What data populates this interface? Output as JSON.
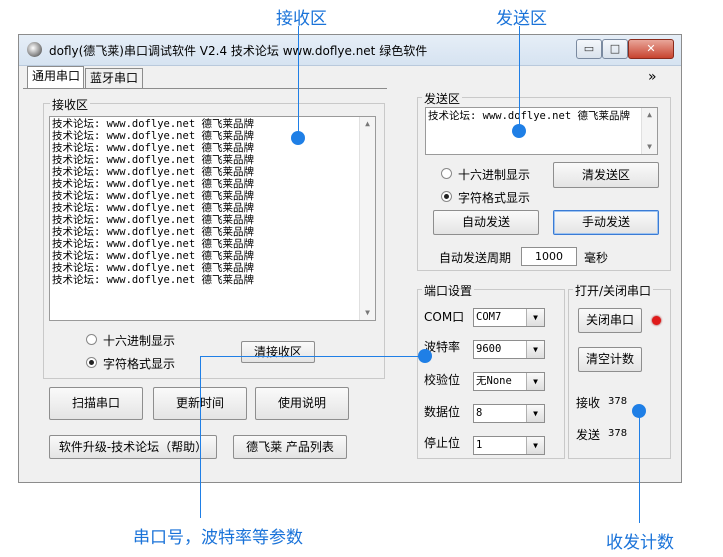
{
  "callouts": {
    "rx_area": "接收区",
    "tx_area": "发送区",
    "port_params": "串口号，波特率等参数",
    "counts": "收发计数"
  },
  "window": {
    "title": "dofly(德飞莱)串口调试软件 V2.4 技术论坛 www.doflye.net 绿色软件",
    "min": "▭",
    "max": "□",
    "close": "✕"
  },
  "tabs": [
    "通用串口",
    "蓝牙串口"
  ],
  "expand_label": "»",
  "receive": {
    "legend": "接收区",
    "lines": [
      "技术论坛: www.doflye.net 德飞莱品牌",
      "技术论坛: www.doflye.net 德飞莱品牌",
      "技术论坛: www.doflye.net 德飞莱品牌",
      "技术论坛: www.doflye.net 德飞莱品牌",
      "技术论坛: www.doflye.net 德飞莱品牌",
      "技术论坛: www.doflye.net 德飞莱品牌",
      "技术论坛: www.doflye.net 德飞莱品牌",
      "技术论坛: www.doflye.net 德飞莱品牌",
      "技术论坛: www.doflye.net 德飞莱品牌",
      "技术论坛: www.doflye.net 德飞莱品牌",
      "技术论坛: www.doflye.net 德飞莱品牌",
      "技术论坛: www.doflye.net 德飞莱品牌",
      "技术论坛: www.doflye.net 德飞莱品牌",
      "技术论坛: www.doflye.net 德飞莱品牌"
    ],
    "hex_label": "十六进制显示",
    "char_label": "字符格式显示",
    "clear_button": "清接收区"
  },
  "bottom_buttons": {
    "scan": "扫描串口",
    "update_time": "更新时间",
    "help": "使用说明",
    "upgrade": "软件升级-技术论坛（帮助）",
    "products": "德飞莱 产品列表"
  },
  "send": {
    "legend": "发送区",
    "text": "技术论坛: www.doflye.net 德飞莱品牌",
    "hex_label": "十六进制显示",
    "char_label": "字符格式显示",
    "clear_button": "清发送区",
    "auto_button": "自动发送",
    "manual_button": "手动发送",
    "period_label": "自动发送周期",
    "period_value": "1000",
    "period_unit": "毫秒"
  },
  "port": {
    "legend": "端口设置",
    "com_label": "COM口",
    "com_value": "COM7",
    "baud_label": "波特率",
    "baud_value": "9600",
    "parity_label": "校验位",
    "parity_value": "无None",
    "data_label": "数据位",
    "data_value": "8",
    "stop_label": "停止位",
    "stop_value": "1"
  },
  "openclose": {
    "legend": "打开/关闭串口",
    "close_button": "关闭串口",
    "clear_count_button": "清空计数",
    "rx_label": "接收",
    "rx_count": "378",
    "tx_label": "发送",
    "tx_count": "378",
    "led_color": "#e01a1a"
  },
  "accent_color": "#1f7fe6"
}
